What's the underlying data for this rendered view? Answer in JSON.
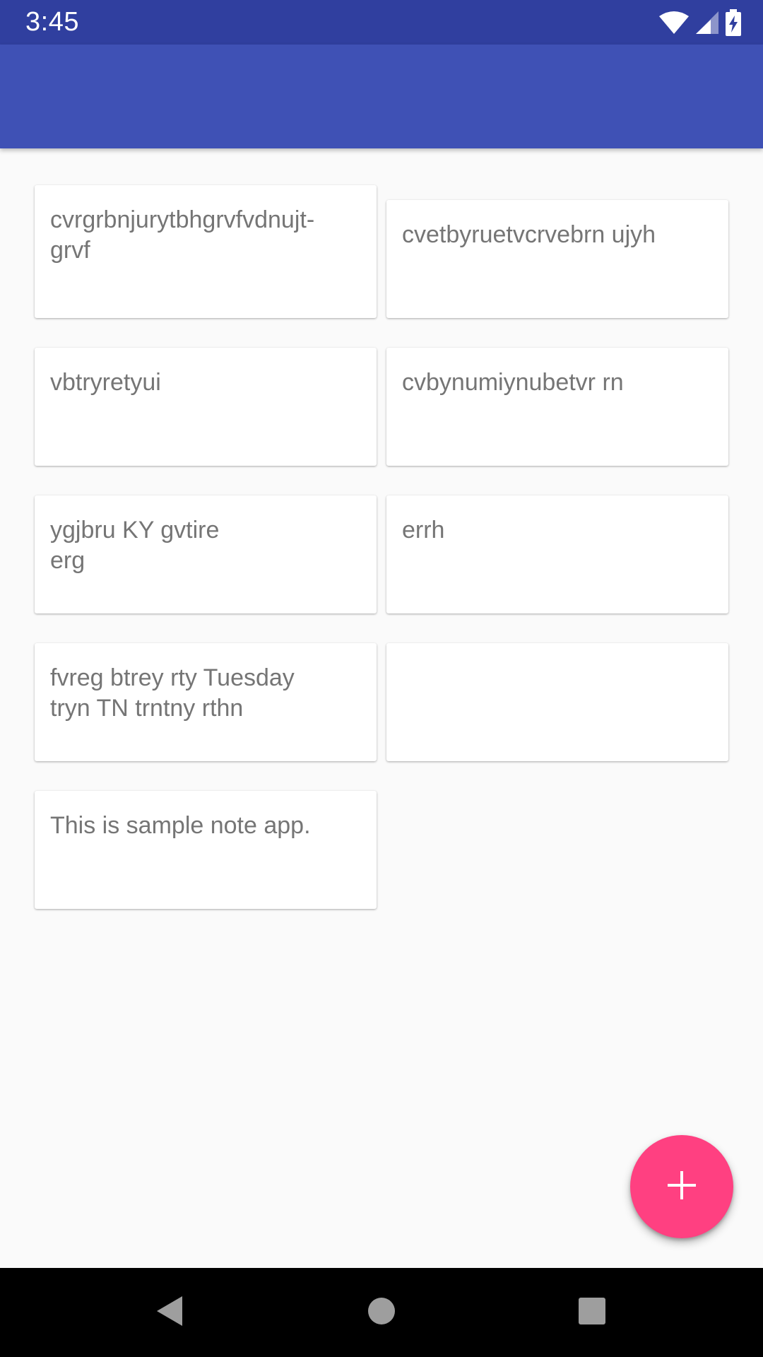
{
  "status_bar": {
    "time": "3:45",
    "icons": [
      "wifi-icon",
      "signal-icon",
      "battery-charging-icon"
    ]
  },
  "app_bar": {
    "title": ""
  },
  "notes": [
    {
      "text": "cvrgrbnjurytbhgrvfvdnujt-\ngrvf"
    },
    {
      "text": "cvetbyruetvcrvebrn ujyh"
    },
    {
      "text": "vbtryretyui"
    },
    {
      "text": "cvbynumiynubetvr rn"
    },
    {
      "text": "ygjbru KY gvtire\nerg"
    },
    {
      "text": "errh"
    },
    {
      "text": "fvreg btrey rty Tuesday\ntryn TN trntny rthn"
    },
    {
      "text": ""
    },
    {
      "text": "This is sample note app."
    }
  ],
  "fab": {
    "icon": "plus-icon"
  },
  "nav_bar": {
    "icons": [
      "back-icon",
      "home-icon",
      "recents-icon"
    ]
  },
  "colors": {
    "status_bar": "#303f9f",
    "app_bar": "#3f51b5",
    "accent": "#ff4081",
    "background": "#fafafa",
    "note_text": "#757575"
  }
}
